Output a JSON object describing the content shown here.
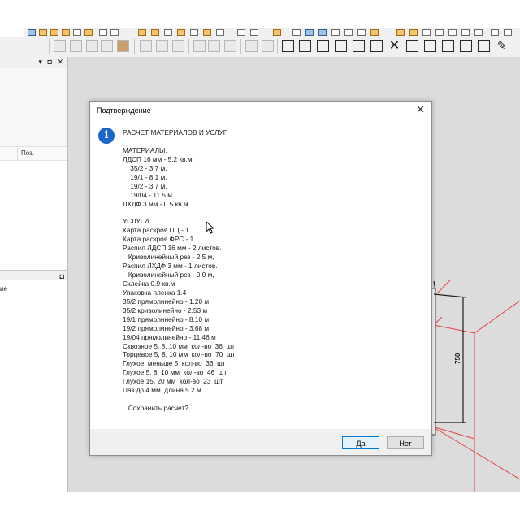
{
  "dialog": {
    "title": "Подтверждение",
    "close_glyph": "✕",
    "icon": "info-icon",
    "message_lines": [
      "РАСЧЕТ МАТЕРИАЛОВ И УСЛУГ.",
      "",
      "МАТЕРИАЛЫ.",
      "ЛДСП 16 мм - 5.2 кв.м.",
      "    35/2 - 3.7 м.",
      "    19/1 - 8.1 м.",
      "    19/2 - 3.7 м.",
      "    19/04 - 11.5 м.",
      "ЛХДФ 3 мм - 0.5 кв.м.",
      "",
      "УСЛУГИ.",
      "Карта раскроя ПЦ - 1",
      "Карта раскроя ФРС - 1",
      "Распил ЛДСП 16 мм - 2 листов.",
      "   Криволинейный рез - 2.5 м,",
      "Распил ЛХДФ 3 мм - 1 листов.",
      "   Криволинейный рез - 0.0 м,",
      "Склейка 0.9 кв.м",
      "Упаковка пленка 1.4",
      "35/2 прямолинейно - 1.20 м",
      "35/2 криволинейно - 2.53 м",
      "19/1 прямолинейно - 8.10 м",
      "19/2 прямолинейно - 3.68 м",
      "19/04 прямолинейно - 11.46 м",
      "Сквозное 5, 8, 10 мм  кол-во  36  шт",
      "Торцевое 5, 8, 10 мм  кол-во  70  шт",
      "Глухое  меньше 5  кол-во  36  шт",
      "Глухое 5, 8, 10 мм  кол-во  46  шт",
      "Глухое 15, 20 мм  кол-во  23  шт",
      "Паз до 4 мм  длина 5.2 м.",
      "",
      "   Сохранить расчет?"
    ],
    "yes_label": "Да",
    "no_label": "Нет"
  },
  "left_panel": {
    "column_header": "Поз.",
    "caption_buttons": "▾ ◘ ✕",
    "bottom_caption_button": "◘",
    "bottom_text": "ие"
  },
  "viewport": {
    "dimension_label": "750"
  },
  "colors": {
    "accent_blue": "#1a66c9",
    "selection_red": "#e8423f",
    "viewport_bg": "#dcdcdc"
  }
}
